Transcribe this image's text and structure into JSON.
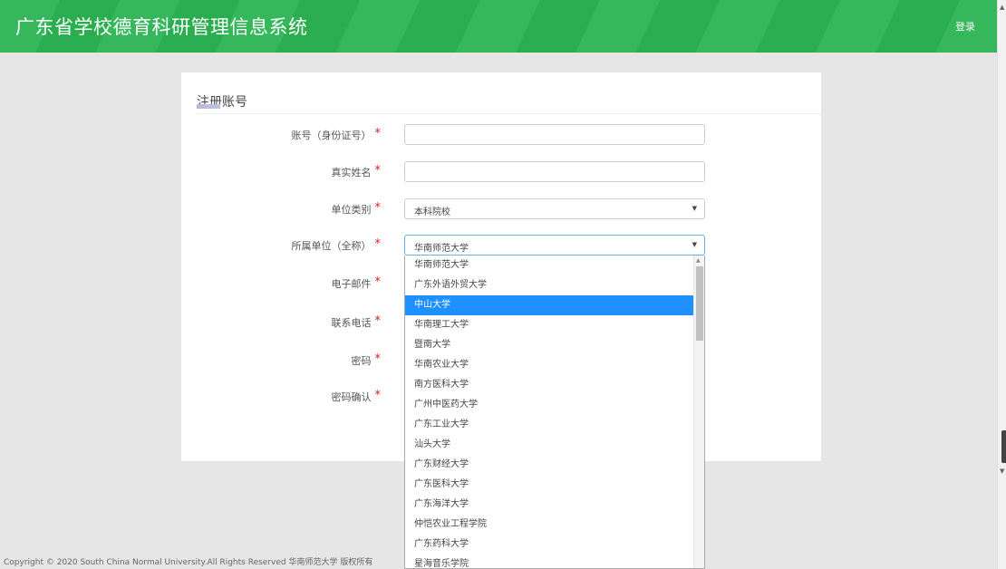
{
  "header": {
    "title": "广东省学校德育科研管理信息系统",
    "login": "登录"
  },
  "panel": {
    "title": "注册账号"
  },
  "form": {
    "account_label": "账号（身份证号）",
    "name_label": "真实姓名",
    "unit_type_label": "单位类别",
    "unit_type_value": "本科院校",
    "unit_label": "所属单位（全称）",
    "unit_value": "华南师范大学",
    "email_label": "电子邮件",
    "phone_label": "联系电话",
    "password_label": "密码",
    "password_confirm_label": "密码确认",
    "required_mark": "*"
  },
  "dropdown": {
    "highlighted_index": 2,
    "options": [
      "华南师范大学",
      "广东外语外贸大学",
      "中山大学",
      "华南理工大学",
      "暨南大学",
      "华南农业大学",
      "南方医科大学",
      "广州中医药大学",
      "广东工业大学",
      "汕头大学",
      "广东财经大学",
      "广东医科大学",
      "广东海洋大学",
      "仲恺农业工程学院",
      "广东药科大学",
      "星海音乐学院"
    ]
  },
  "footer": {
    "copyright": "Copyright © 2020 South China Normal University.All Rights Reserved 华南师范大学 版权所有"
  }
}
